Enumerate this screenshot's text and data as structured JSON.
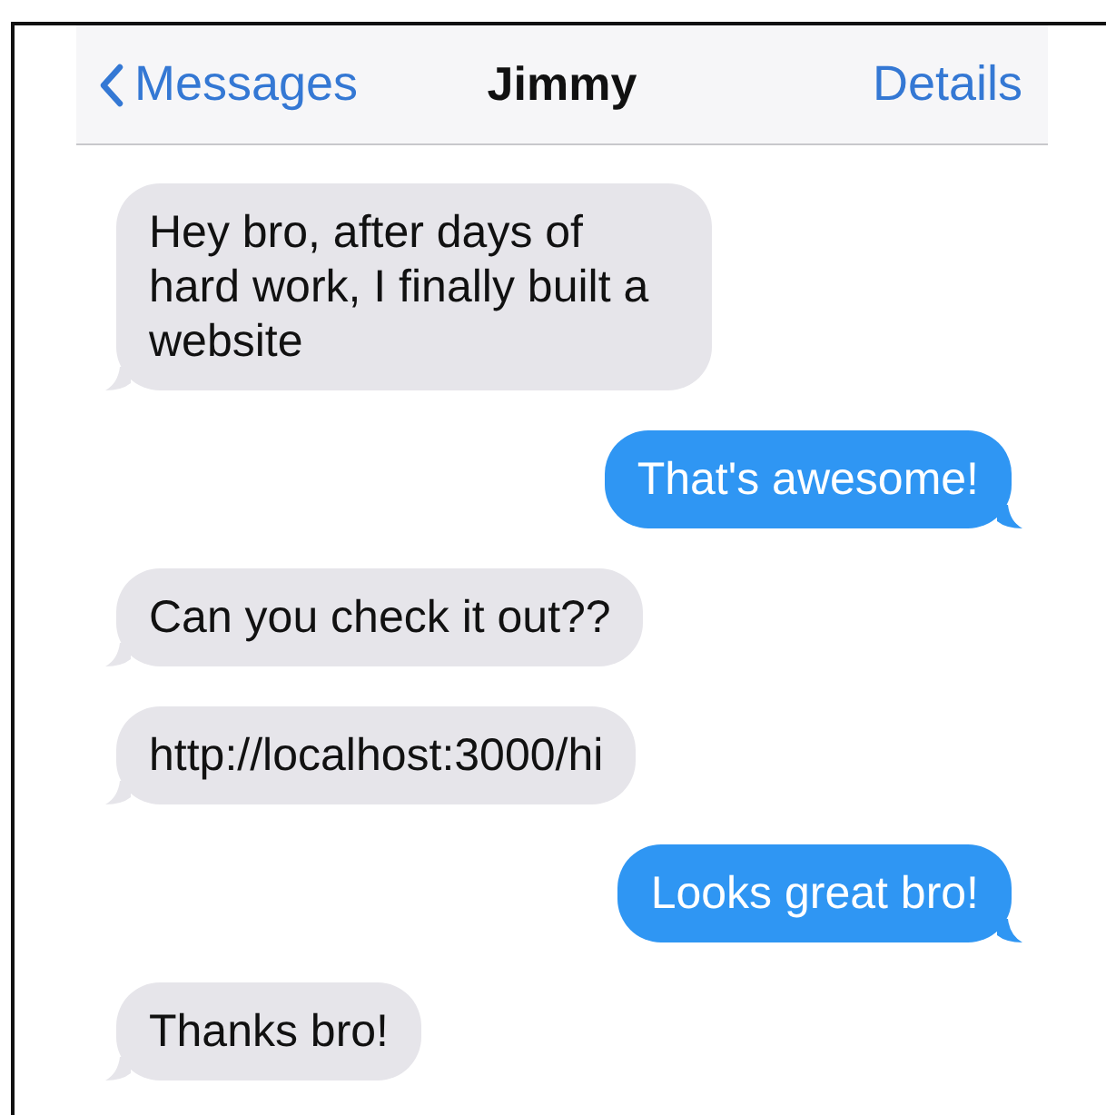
{
  "nav_bar": {
    "back": "Messages",
    "title": "Jimmy",
    "action": "Details"
  },
  "messages": [
    {
      "kind": "received",
      "text": "Hey bro, after days of hard work, I finally built a website"
    },
    {
      "kind": "sent",
      "text": "That's awesome!"
    },
    {
      "kind": "received",
      "text": "Can you check it out??"
    },
    {
      "kind": "received",
      "text": "http://localhost:3000/hi"
    },
    {
      "kind": "sent",
      "text": "Looks great bro!"
    },
    {
      "kind": "received",
      "text": "Thanks bro!"
    }
  ]
}
